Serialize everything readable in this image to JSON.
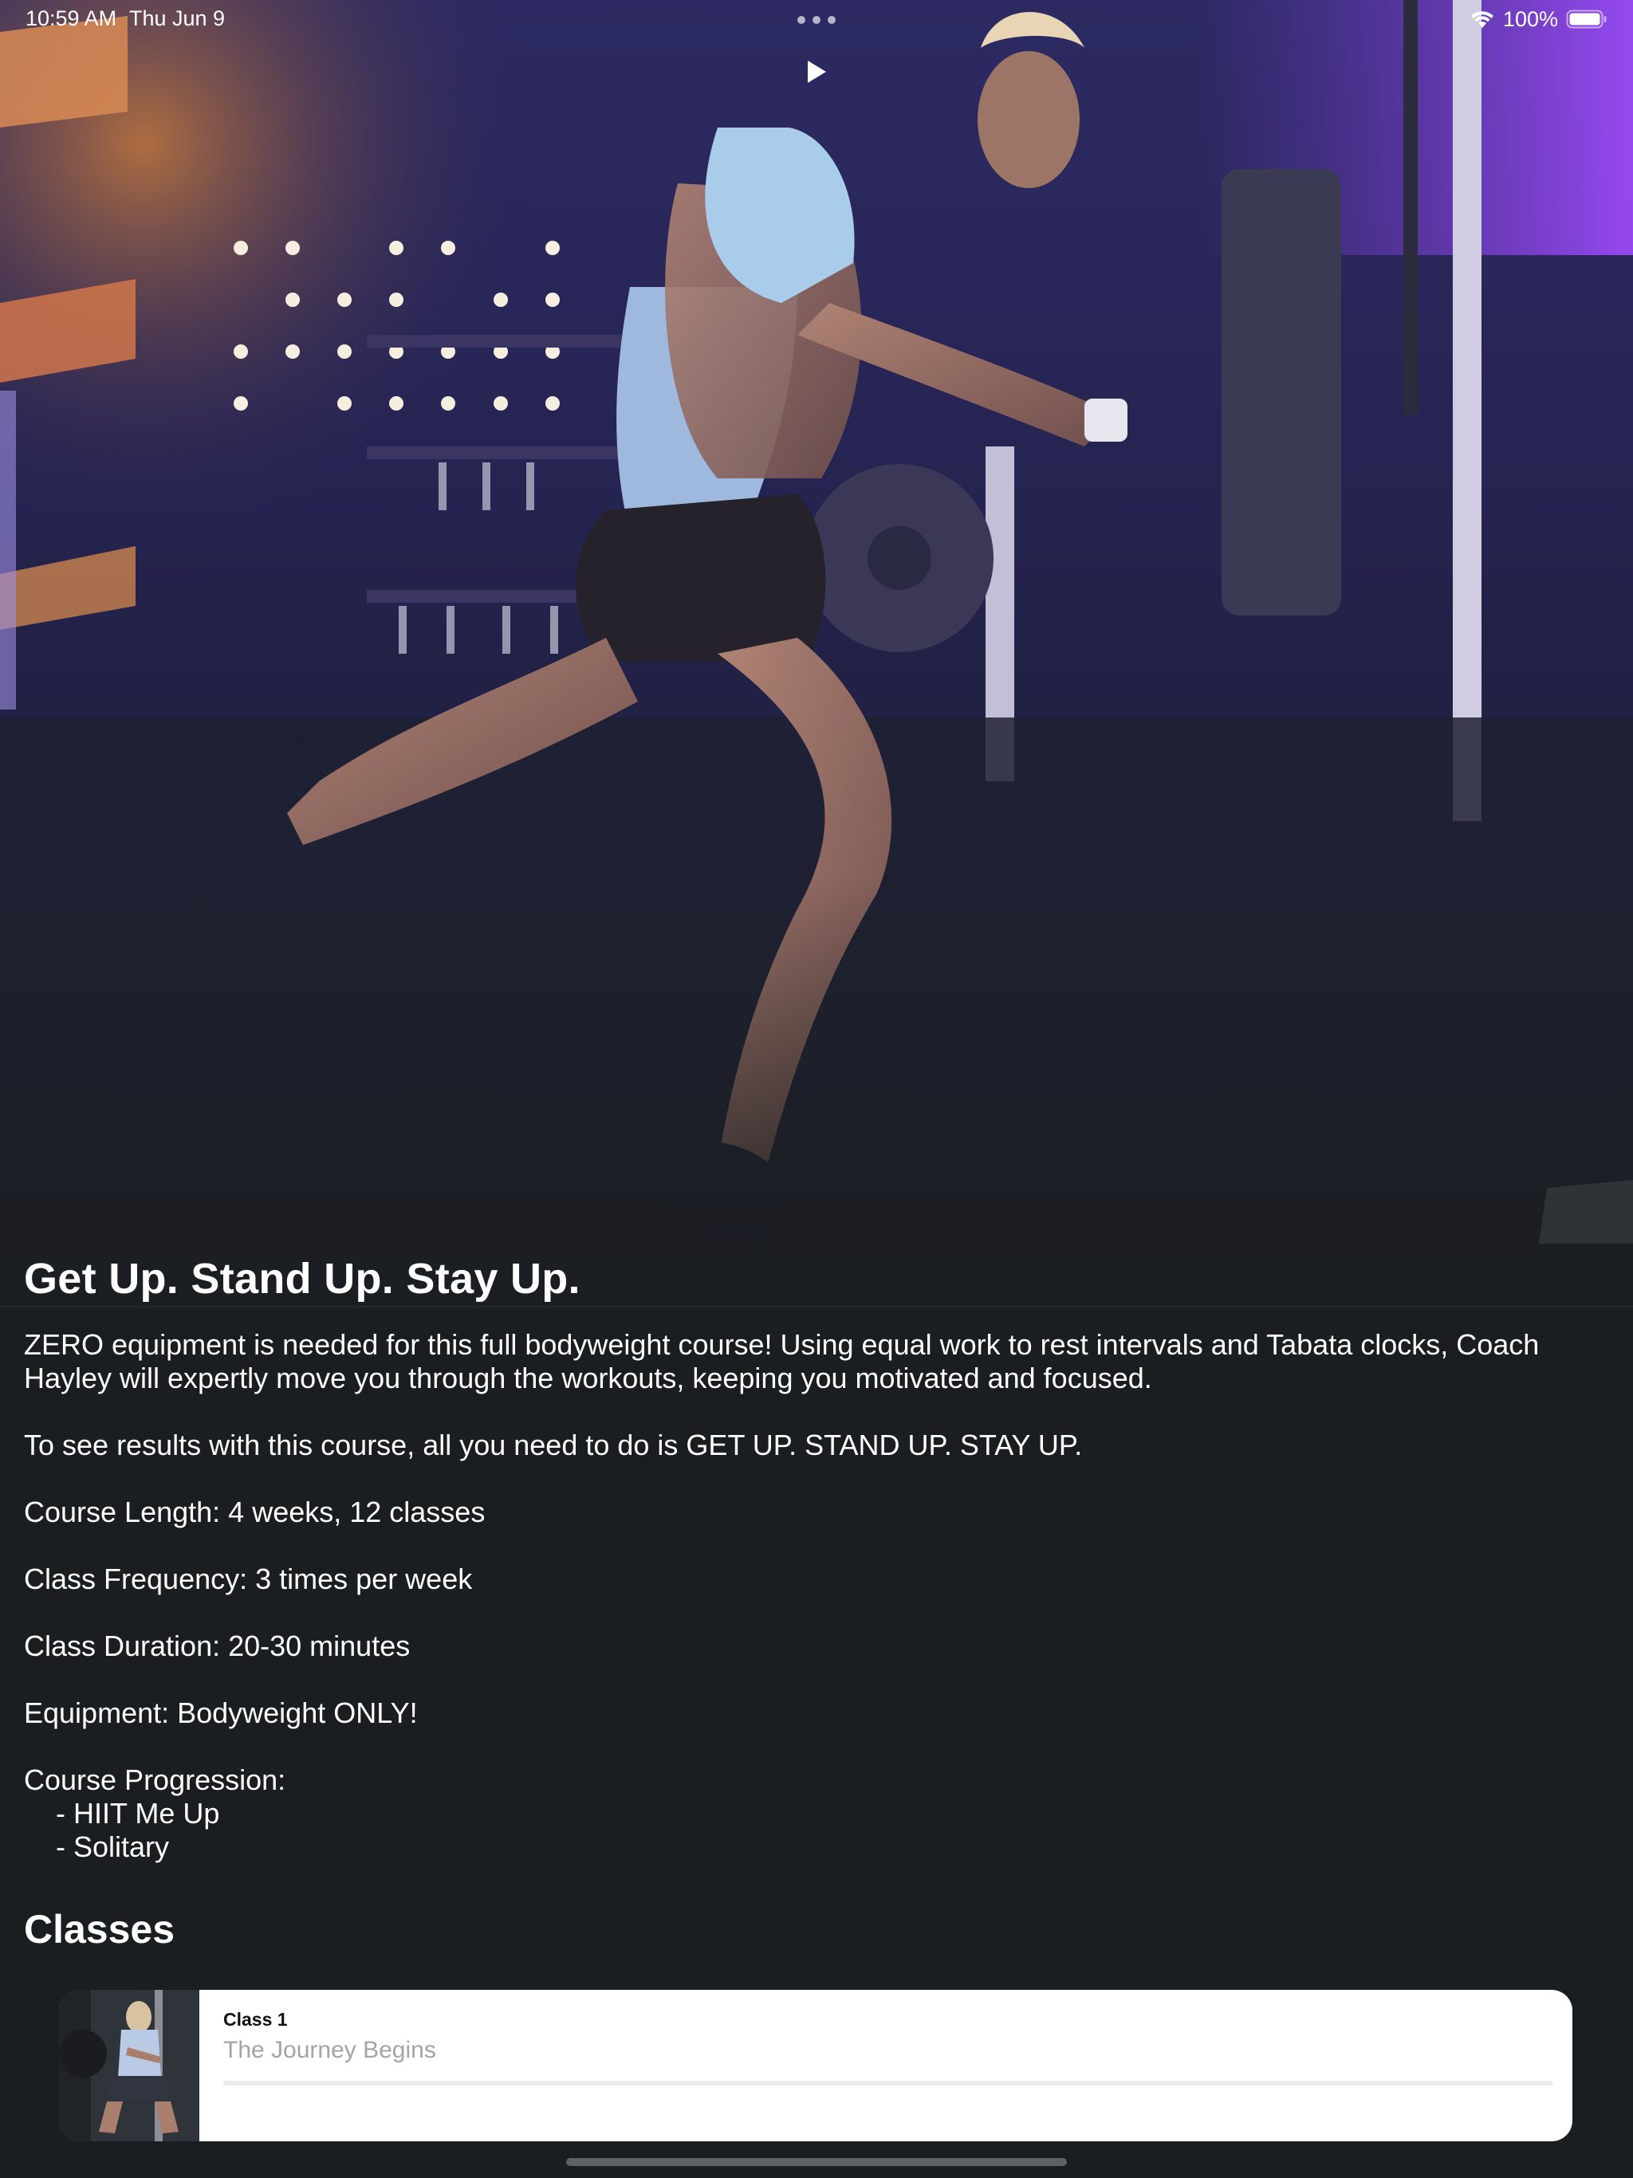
{
  "status_bar": {
    "time": "10:59 AM",
    "date": "Thu Jun 9",
    "battery": "100%"
  },
  "hero": {
    "play_icon": "play-icon",
    "brand_color": "#4a3fb0"
  },
  "course": {
    "title": "Get Up. Stand Up. Stay Up.",
    "intro": "ZERO equipment is needed for this full bodyweight course! Using equal work to rest intervals and Tabata clocks, Coach Hayley will expertly move you through the workouts, keeping you motivated and focused.",
    "tagline": "To see results with this course, all you need to do is GET UP. STAND UP. STAY UP.",
    "length": "Course Length: 4 weeks, 12 classes",
    "frequency": "Class Frequency: 3 times per week",
    "duration": "Class Duration: 20-30 minutes",
    "equipment": "Equipment: Bodyweight ONLY!",
    "progression_label": "Course Progression:",
    "progression": [
      "- HIIT Me Up",
      "- Solitary"
    ]
  },
  "classes": {
    "heading": "Classes",
    "items": [
      {
        "label": "Class 1",
        "name": "The Journey Begins",
        "progress": 0
      }
    ]
  }
}
